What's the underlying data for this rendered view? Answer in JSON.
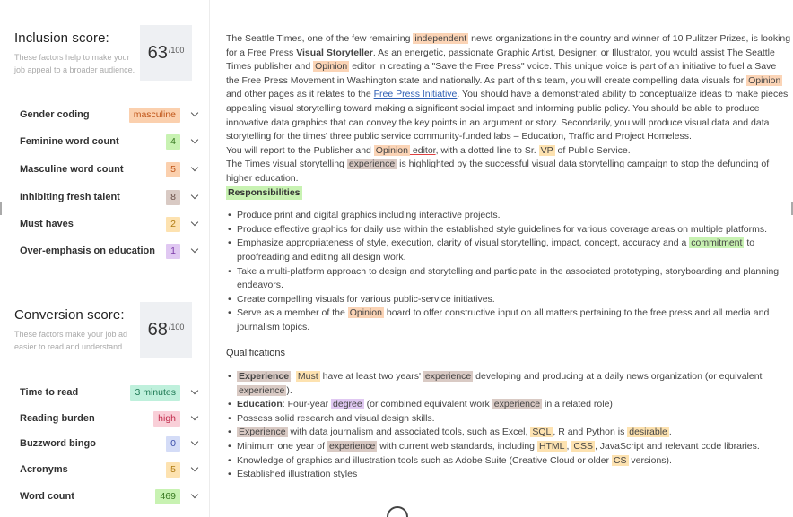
{
  "inclusion": {
    "title": "Inclusion score:",
    "desc": "These factors help to make your job appeal to a broader audience.",
    "score": "63",
    "den": "/100",
    "metrics": [
      {
        "label": "Gender coding",
        "value": "masculine",
        "bg": "#fbd0ae",
        "fg": "#c0561a"
      },
      {
        "label": "Feminine word count",
        "value": "4",
        "bg": "#c8f2b2",
        "fg": "#3a7a23"
      },
      {
        "label": "Masculine word count",
        "value": "5",
        "bg": "#fbd0ae",
        "fg": "#c0561a"
      },
      {
        "label": "Inhibiting fresh talent",
        "value": "8",
        "bg": "#d9cac4",
        "fg": "#6b5048"
      },
      {
        "label": "Must haves",
        "value": "2",
        "bg": "#fde2b0",
        "fg": "#b07b12"
      },
      {
        "label": "Over-emphasis on education",
        "value": "1",
        "bg": "#e0c8f2",
        "fg": "#7b3ba8"
      }
    ]
  },
  "conversion": {
    "title": "Conversion score:",
    "desc": "These factors make your job ad easier to read and understand.",
    "score": "68",
    "den": "/100",
    "metrics": [
      {
        "label": "Time to read",
        "value": "3 minutes",
        "bg": "#bff0dc",
        "fg": "#1f7a55"
      },
      {
        "label": "Reading burden",
        "value": "high",
        "bg": "#f9cfd8",
        "fg": "#c02a4a"
      },
      {
        "label": "Buzzword bingo",
        "value": "0",
        "bg": "#d4dcf7",
        "fg": "#3a4ca8"
      },
      {
        "label": "Acronyms",
        "value": "5",
        "bg": "#fde2b0",
        "fg": "#b07b12"
      },
      {
        "label": "Word count",
        "value": "469",
        "bg": "#c8f2b2",
        "fg": "#3a7a23"
      }
    ]
  },
  "text": {
    "p1": {
      "a": "The Seattle Times, one of the few remaining ",
      "h1": "independent",
      "b": " news organizations in the country and winner of 10 Pulitzer Prizes, is looking for a Free Press ",
      "bold": "Visual Storyteller",
      "c": ". As an energetic, passionate Graphic Artist, Designer, or Illustrator, you would assist The Seattle Times publisher and ",
      "h2": "Opinion",
      "d": " editor in creating a \"Save the Free Press\" voice. This unique voice is part of an initiative to fuel a Save the Free Press Movement in Washington state and nationally. As part of this team, you will create compelling data visuals for ",
      "h3": "Opinion",
      "e": " and other pages as it relates to the ",
      "link": "Free Press Initiative",
      "f": ". You should have a demonstrated ability to conceptualize ideas to make pieces appealing visual storytelling toward making a significant social impact and informing public policy. You should be able to produce innovative data graphics that can convey the key points in an argument or story. Secondarily, you will produce visual data and data storytelling for the times' three public service community-funded labs – Education, Traffic and Project Homeless."
    },
    "p2": {
      "a": "You will report to the Publisher and ",
      "h1": "Opinion",
      "wavy": " editor",
      "b": ", with a dotted line to Sr. ",
      "h2": "VP",
      "c": " of Public Service."
    },
    "p3": {
      "a": "The Times visual storytelling ",
      "h1": "experience",
      "b": " is highlighted by the successful visual data storytelling campaign to stop the defunding of higher education."
    },
    "responsibilities_title": "Responsibilities",
    "resp": {
      "r1": "Produce print and digital graphics including interactive projects.",
      "r2": "Produce effective graphics for daily use within the established style guidelines for various coverage areas on multiple platforms.",
      "r3a": "Emphasize appropriateness of style, execution, clarity of visual storytelling, impact, concept, accuracy and a ",
      "r3h": "commitment",
      "r3b": " to proofreading and editing all design work.",
      "r4": "Take a multi-platform approach to design and storytelling and participate in the associated prototyping, storyboarding and planning endeavors.",
      "r5": "Create compelling visuals for various public-service initiatives.",
      "r6a": "Serve as a member of the ",
      "r6h": "Opinion",
      "r6b": " board to offer constructive input on all matters pertaining to the free press and all media and journalism topics."
    },
    "qualifications_title": "Qualifications",
    "qual": {
      "q1h1": "Experience",
      "q1a": ": ",
      "q1h2": "Must",
      "q1b": " have at least two years' ",
      "q1h3": "experience",
      "q1c": " developing and producing at a daily news organization (or equivalent ",
      "q1h4": "experience",
      "q1d": ").",
      "q2bold": "Education",
      "q2a": ": Four-year ",
      "q2h1": "degree",
      "q2b": " (or combined equivalent work ",
      "q2h2": "experience",
      "q2c": " in a related role)",
      "q3": "Possess solid research and visual design skills.",
      "q4h1": "Experience",
      "q4a": " with data journalism and associated tools, such as Excel, ",
      "q4h2": "SQL",
      "q4b": ", R and Python is ",
      "q4h3": "desirable",
      "q4c": ".",
      "q5a": "Minimum one year of ",
      "q5h1": "experience",
      "q5b": " with current web standards, including ",
      "q5h2": "HTML",
      "q5c": ", ",
      "q5h3": "CSS",
      "q5d": ", JavaScript and relevant code libraries.",
      "q6a": "Knowledge of graphics and illustration tools such as Adobe Suite (Creative Cloud or older ",
      "q6h1": "CS",
      "q6b": " versions).",
      "q7": "Established illustration styles"
    }
  }
}
